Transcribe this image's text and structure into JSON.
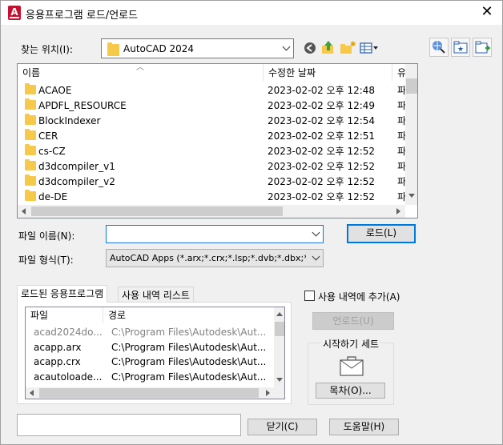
{
  "window": {
    "title": "응용프로그램 로드/언로드",
    "app_icon_letter": "A"
  },
  "look_in": {
    "label": "찾는 위치(I):",
    "value": "AutoCAD 2024"
  },
  "toolbar": {
    "back_icon": "back-icon",
    "up_icon": "up-folder-icon",
    "new_folder_icon": "new-folder-icon",
    "views_icon": "views-menu-icon",
    "search_web_icon": "search-web-icon",
    "favorites_icon": "favorites-icon",
    "add_favorite_icon": "add-to-favorites-icon"
  },
  "file_list": {
    "columns": [
      "이름",
      "수정한 날짜",
      "유"
    ],
    "rows": [
      {
        "name": "ACAOE",
        "date": "2023-02-02 오후 12:48",
        "type": "파"
      },
      {
        "name": "APDFL_RESOURCE",
        "date": "2023-02-02 오후 12:49",
        "type": "파"
      },
      {
        "name": "BlockIndexer",
        "date": "2023-02-02 오후 12:54",
        "type": "파"
      },
      {
        "name": "CER",
        "date": "2023-02-02 오후 12:51",
        "type": "파"
      },
      {
        "name": "cs-CZ",
        "date": "2023-02-02 오후 12:52",
        "type": "파"
      },
      {
        "name": "d3dcompiler_v1",
        "date": "2023-02-02 오후 12:52",
        "type": "파"
      },
      {
        "name": "d3dcompiler_v2",
        "date": "2023-02-02 오후 12:52",
        "type": "파"
      },
      {
        "name": "de-DE",
        "date": "2023-02-02 오후 12:52",
        "type": "파"
      }
    ]
  },
  "file_name": {
    "label": "파일 이름(N):",
    "value": ""
  },
  "file_type": {
    "label": "파일 형식(T):",
    "value": "AutoCAD Apps (*.arx;*.crx;*.lsp;*.dvb;*.dbx;*.v"
  },
  "load_button": "로드(L)",
  "tabs": [
    "로드된 응용프로그램",
    "사용 내역 리스트"
  ],
  "loaded_apps": {
    "columns": [
      "파일",
      "경로"
    ],
    "rows": [
      {
        "file": "acad2024do...",
        "path": "C:\\Program Files\\Autodesk\\Aut...",
        "dim": true
      },
      {
        "file": "acapp.arx",
        "path": "C:\\Program Files\\Autodesk\\Aut...",
        "dim": false
      },
      {
        "file": "acapp.crx",
        "path": "C:\\Program Files\\Autodesk\\Aut...",
        "dim": false
      },
      {
        "file": "acautoloade...",
        "path": "C:\\Program Files\\Autodesk\\Aut...",
        "dim": false
      }
    ]
  },
  "add_to_history": {
    "label": "사용 내역에 추가(A)",
    "checked": false
  },
  "unload_button": "언로드(U)",
  "startup_suite": {
    "title": "시작하기 세트",
    "contents_button": "목차(O)..."
  },
  "close_button": "닫기(C)",
  "help_button": "도움말(H)",
  "status_text": ""
}
